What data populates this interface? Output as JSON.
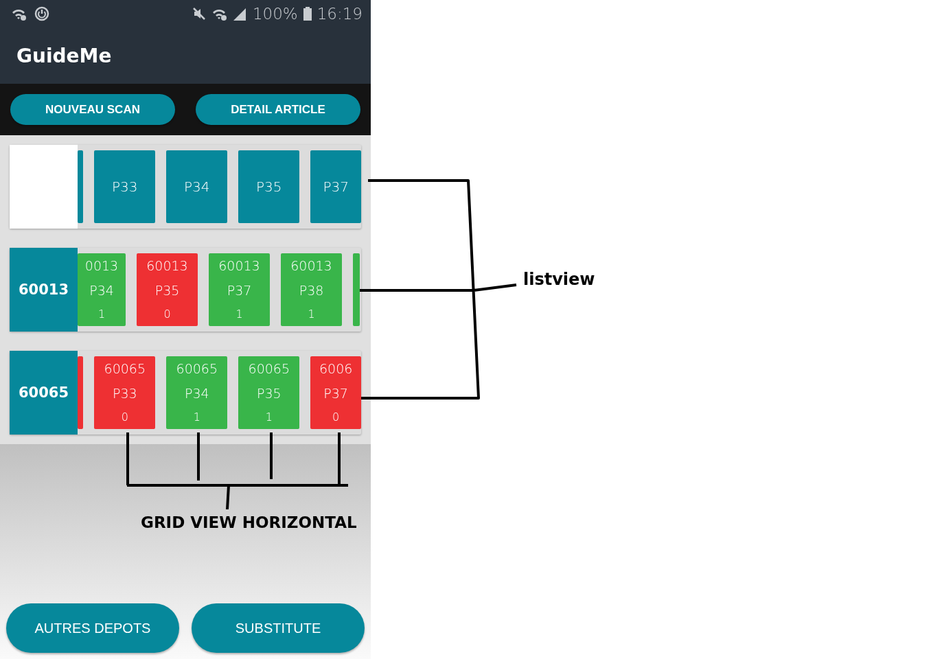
{
  "status_bar": {
    "battery": "100%",
    "time": "16:19"
  },
  "app_bar": {
    "title": "GuideMe"
  },
  "top_buttons": [
    "NOUVEAU SCAN",
    "DETAIL ARTICLE"
  ],
  "lists": [
    {
      "header": {
        "kind": "blank"
      },
      "tiles": [
        {
          "kind": "edge",
          "color": "#06889b"
        },
        {
          "kind": "tile",
          "color": "#06889b",
          "lines": [
            "P33"
          ]
        },
        {
          "kind": "tile",
          "color": "#06889b",
          "lines": [
            "P34"
          ]
        },
        {
          "kind": "tile",
          "color": "#06889b",
          "lines": [
            "P35"
          ]
        },
        {
          "kind": "tile",
          "color": "#06889b",
          "lines": [
            "P37"
          ]
        }
      ]
    },
    {
      "header": {
        "kind": "label",
        "text": "60013"
      },
      "tiles": [
        {
          "kind": "cut",
          "color": "#39b54a",
          "lines": [
            "0013",
            "P34",
            "1"
          ]
        },
        {
          "kind": "tile",
          "color": "#ee3033",
          "lines": [
            "60013",
            "P35",
            "0"
          ]
        },
        {
          "kind": "tile",
          "color": "#39b54a",
          "lines": [
            "60013",
            "P37",
            "1"
          ]
        },
        {
          "kind": "tile",
          "color": "#39b54a",
          "lines": [
            "60013",
            "P38",
            "1"
          ]
        },
        {
          "kind": "edge",
          "color": "#39b54a"
        }
      ]
    },
    {
      "header": {
        "kind": "label",
        "text": "60065"
      },
      "tiles": [
        {
          "kind": "edge",
          "color": "#ee3033"
        },
        {
          "kind": "tile",
          "color": "#ee3033",
          "lines": [
            "60065",
            "P33",
            "0"
          ]
        },
        {
          "kind": "tile",
          "color": "#39b54a",
          "lines": [
            "60065",
            "P34",
            "1"
          ]
        },
        {
          "kind": "tile",
          "color": "#39b54a",
          "lines": [
            "60065",
            "P35",
            "1"
          ]
        },
        {
          "kind": "tile",
          "color": "#ee3033",
          "lines": [
            "6006",
            "P37",
            "0"
          ]
        }
      ]
    }
  ],
  "bottom_buttons": [
    "AUTRES DEPOTS",
    "SUBSTITUTE"
  ],
  "annotations": [
    {
      "kind": "listview",
      "label": "listview"
    },
    {
      "kind": "grid",
      "label": "GRID VIEW HORIZONTAL"
    }
  ]
}
